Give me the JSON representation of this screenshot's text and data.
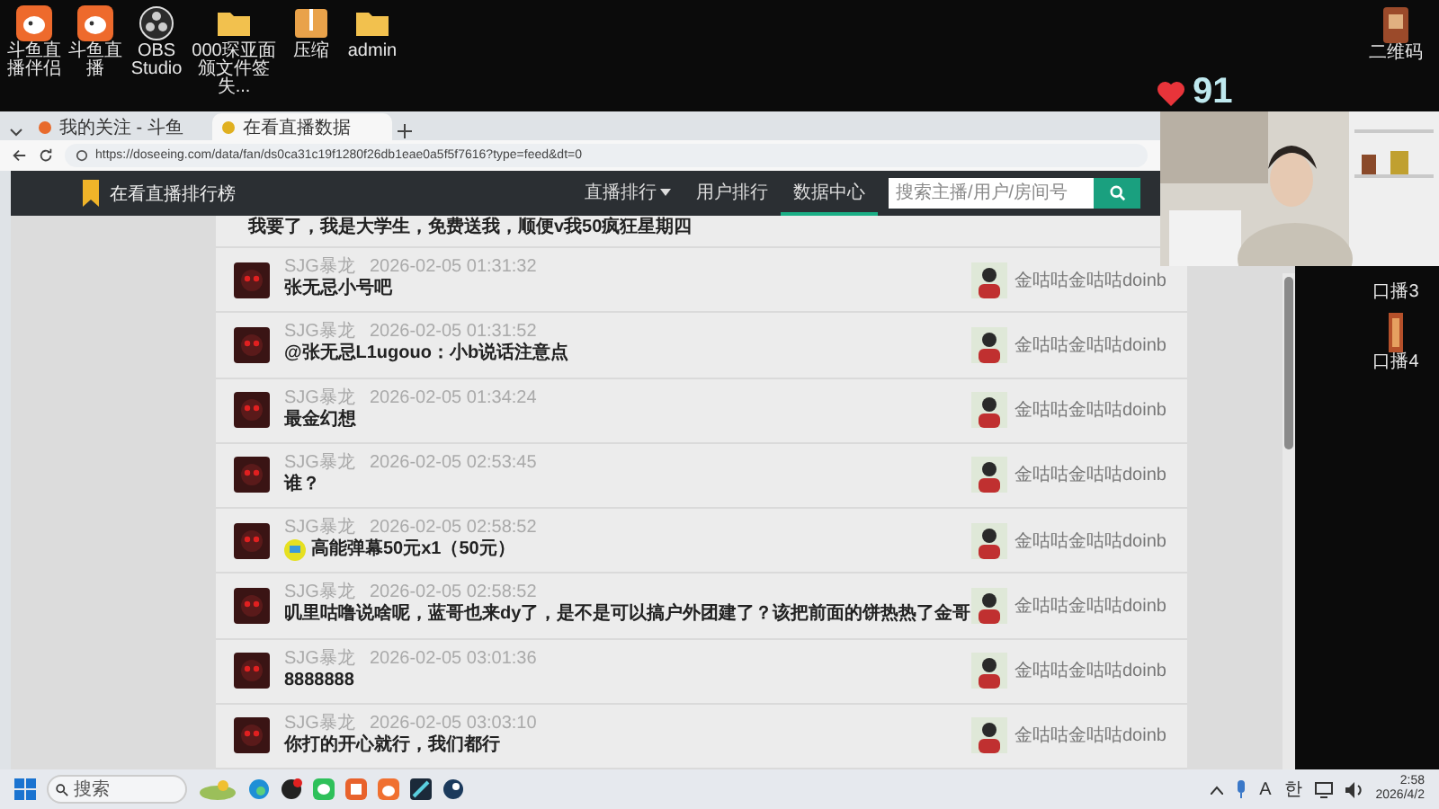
{
  "desktop_icons": [
    {
      "label": "斗鱼直播伴侣",
      "kind": "douyu"
    },
    {
      "label": "斗鱼直播",
      "kind": "douyu"
    },
    {
      "label": "OBS Studio",
      "kind": "obs"
    },
    {
      "label": "000琛亚面颁文件签失...",
      "kind": "folder"
    },
    {
      "label": "压缩",
      "kind": "zip"
    },
    {
      "label": "admin",
      "kind": "folder"
    }
  ],
  "right_icons": [
    {
      "label": "二维码",
      "kind": "qr"
    },
    {
      "label": "口播3",
      "kind": "hidden"
    },
    {
      "label": "口播4",
      "kind": "banner"
    }
  ],
  "likes": "91",
  "browser": {
    "tabs": [
      {
        "label": "我的关注 - 斗鱼",
        "selected": false
      },
      {
        "label": "在看直播数据",
        "selected": true
      }
    ],
    "url": "https://doseeing.com/data/fan/ds0ca31c19f1280f26db1eae0a5f5f7616?type=feed&dt=0"
  },
  "site": {
    "title": "在看直播排行榜",
    "nav": [
      {
        "label": "直播排行",
        "selected": false,
        "dropdown": true
      },
      {
        "label": "用户排行",
        "selected": false,
        "dropdown": false
      },
      {
        "label": "数据中心",
        "selected": true,
        "dropdown": false
      }
    ],
    "search": {
      "placeholder": "搜索主播/用户/房间号"
    }
  },
  "feed": [
    {
      "kind": "partial",
      "message": "我要了，我是大学生，免费送我，顺便v我50疯狂星期四"
    },
    {
      "kind": "text",
      "user": "SJG暴龙",
      "time": "2026-02-05 01:31:32",
      "message": "张无忌小号吧",
      "streamer": "金咕咕金咕咕doinb"
    },
    {
      "kind": "text",
      "user": "SJG暴龙",
      "time": "2026-02-05 01:31:52",
      "message": "@张无忌L1ugouo：小b说话注意点",
      "streamer": "金咕咕金咕咕doinb"
    },
    {
      "kind": "text",
      "user": "SJG暴龙",
      "time": "2026-02-05 01:34:24",
      "message": "最金幻想",
      "streamer": "金咕咕金咕咕doinb"
    },
    {
      "kind": "text",
      "user": "SJG暴龙",
      "time": "2026-02-05 02:53:45",
      "message": "谁？",
      "streamer": "金咕咕金咕咕doinb"
    },
    {
      "kind": "gift",
      "user": "SJG暴龙",
      "time": "2026-02-05 02:58:52",
      "message": "高能弹幕50元x1（50元）",
      "streamer": "金咕咕金咕咕doinb"
    },
    {
      "kind": "text",
      "user": "SJG暴龙",
      "time": "2026-02-05 02:58:52",
      "message": "叽里咕噜说啥呢，蓝哥也来dy了，是不是可以搞户外团建了？该把前面的饼热热了金哥",
      "streamer": "金咕咕金咕咕doinb"
    },
    {
      "kind": "text",
      "user": "SJG暴龙",
      "time": "2026-02-05 03:01:36",
      "message": "8888888",
      "streamer": "金咕咕金咕咕doinb"
    },
    {
      "kind": "text",
      "user": "SJG暴龙",
      "time": "2026-02-05 03:03:10",
      "message": "你打的开心就行，我们都行",
      "streamer": "金咕咕金咕咕doinb"
    }
  ],
  "taskbar": {
    "search": {
      "placeholder": "搜索"
    },
    "tray": [
      "A",
      "한"
    ],
    "time": "2:58",
    "date": "2026/4/2"
  }
}
